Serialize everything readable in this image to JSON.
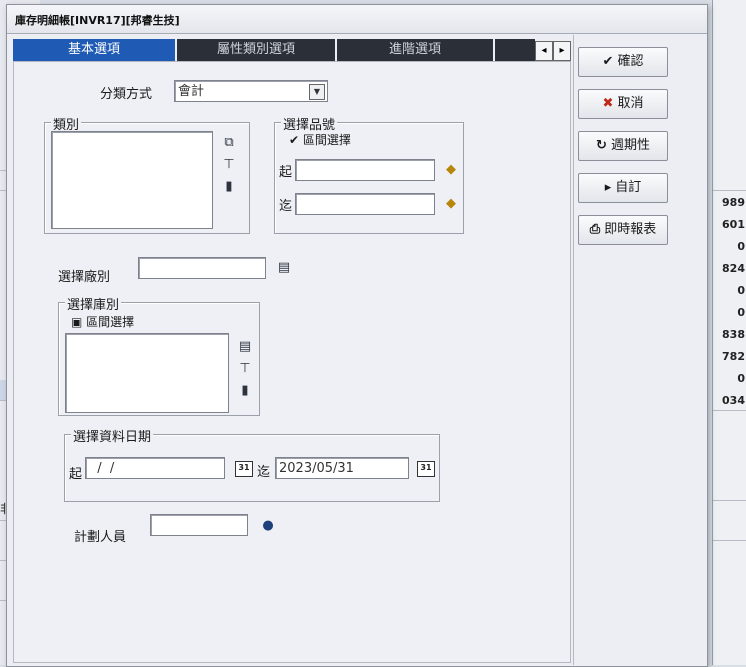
{
  "dialog": {
    "title": "庫存明細帳[INVR17][邦睿生技]"
  },
  "tabs": [
    {
      "label": "基本選項",
      "active": true
    },
    {
      "label": "屬性類別選項",
      "active": false
    },
    {
      "label": "進階選項",
      "active": false
    }
  ],
  "tab_scroll": {
    "left": "◂",
    "right": "▸"
  },
  "form": {
    "classify_label": "分類方式",
    "classify_value": "會計",
    "category_group": "類別",
    "item_group": "選擇品號",
    "item_range_label": "區間選擇",
    "from_label": "起",
    "to_label": "迄",
    "factory_label": "選擇廠別",
    "warehouse_group": "選擇庫別",
    "warehouse_range_label": "區間選擇",
    "date_group": "選擇資料日期",
    "date_from_label": "起",
    "date_from_value": "  /  /",
    "date_to_label": "迄",
    "date_to_value": "2023/05/31",
    "planner_label": "計劃人員"
  },
  "buttons": {
    "ok": "確認",
    "cancel": "取消",
    "periodic": "週期性",
    "custom": "自訂",
    "instant_report": "即時報表"
  },
  "background_numbers": [
    "989",
    "601",
    "0",
    "824",
    "0",
    "0",
    "838",
    "782",
    "0",
    "034"
  ],
  "background_left_text": "非以",
  "colors": {
    "active_tab": "#1f5bb5",
    "tab": "#2b2f38",
    "dialog_bg": "#eceef3"
  }
}
